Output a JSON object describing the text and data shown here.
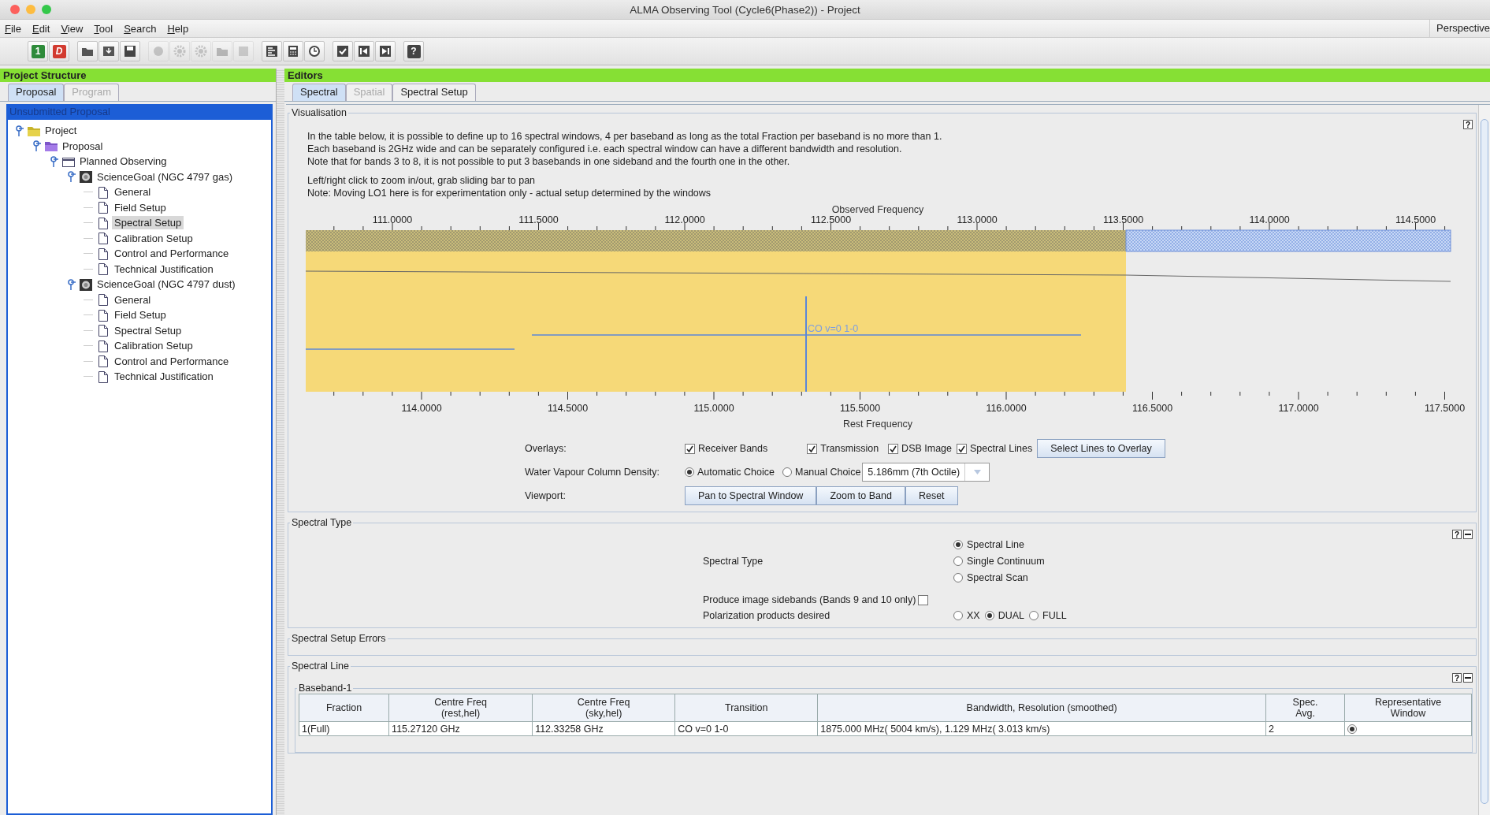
{
  "window": {
    "title": "ALMA Observing Tool (Cycle6(Phase2)) - Project"
  },
  "menu": [
    {
      "label": "File"
    },
    {
      "label": "Edit"
    },
    {
      "label": "View"
    },
    {
      "label": "Tool"
    },
    {
      "label": "Search"
    },
    {
      "label": "Help"
    }
  ],
  "perspective": "Perspective",
  "toolbar": [
    [
      {
        "kind": "green-tile",
        "text": "1",
        "disabled": false
      },
      {
        "kind": "red-tile",
        "text": "D",
        "disabled": false
      }
    ],
    [
      {
        "kind": "folder",
        "disabled": false
      },
      {
        "kind": "import",
        "disabled": false
      },
      {
        "kind": "save",
        "disabled": false
      }
    ],
    [
      {
        "kind": "circle",
        "disabled": true
      },
      {
        "kind": "gear",
        "disabled": true
      },
      {
        "kind": "gear",
        "disabled": true
      },
      {
        "kind": "folder",
        "disabled": true
      },
      {
        "kind": "square",
        "disabled": true
      }
    ],
    [
      {
        "kind": "lines",
        "disabled": false
      },
      {
        "kind": "calculator",
        "disabled": false
      },
      {
        "kind": "clock",
        "disabled": false
      }
    ],
    [
      {
        "kind": "check",
        "disabled": false
      },
      {
        "kind": "first",
        "disabled": false
      },
      {
        "kind": "last",
        "disabled": false
      }
    ],
    [
      {
        "kind": "dark-tile",
        "text": "?",
        "disabled": false
      }
    ]
  ],
  "project_structure": {
    "title": "Project Structure",
    "tabs": [
      {
        "label": "Proposal",
        "selected": true,
        "disabled": false
      },
      {
        "label": "Program",
        "selected": false,
        "disabled": true
      }
    ],
    "tree_header": "Unsubmitted Proposal",
    "tree": [
      {
        "label": "Project",
        "kind": "folder-yellow",
        "expanded": true,
        "selected": false,
        "children": [
          {
            "label": "Proposal",
            "kind": "folder-purple",
            "expanded": true,
            "selected": false,
            "children": [
              {
                "label": "Planned Observing",
                "kind": "window",
                "expanded": true,
                "selected": false,
                "children": [
                  {
                    "label": "ScienceGoal (NGC 4797 gas)",
                    "kind": "goal",
                    "expanded": true,
                    "selected": false,
                    "children": [
                      {
                        "label": "General",
                        "kind": "page",
                        "selected": false
                      },
                      {
                        "label": "Field Setup",
                        "kind": "page",
                        "selected": false
                      },
                      {
                        "label": "Spectral Setup",
                        "kind": "page",
                        "selected": true
                      },
                      {
                        "label": "Calibration Setup",
                        "kind": "page",
                        "selected": false
                      },
                      {
                        "label": "Control and Performance",
                        "kind": "page",
                        "selected": false
                      },
                      {
                        "label": "Technical Justification",
                        "kind": "page",
                        "selected": false
                      }
                    ]
                  },
                  {
                    "label": "ScienceGoal (NGC 4797 dust)",
                    "kind": "goal",
                    "expanded": true,
                    "selected": false,
                    "children": [
                      {
                        "label": "General",
                        "kind": "page",
                        "selected": false
                      },
                      {
                        "label": "Field Setup",
                        "kind": "page",
                        "selected": false
                      },
                      {
                        "label": "Spectral Setup",
                        "kind": "page",
                        "selected": false
                      },
                      {
                        "label": "Calibration Setup",
                        "kind": "page",
                        "selected": false
                      },
                      {
                        "label": "Control and Performance",
                        "kind": "page",
                        "selected": false
                      },
                      {
                        "label": "Technical Justification",
                        "kind": "page",
                        "selected": false
                      }
                    ]
                  }
                ]
              }
            ]
          }
        ]
      }
    ]
  },
  "editors": {
    "title": "Editors",
    "tabs": [
      {
        "label": "Spectral",
        "selected": true,
        "disabled": false
      },
      {
        "label": "Spatial",
        "selected": false,
        "disabled": true
      },
      {
        "label": "Spectral Setup",
        "selected": false,
        "disabled": false
      }
    ],
    "visualisation": {
      "title": "Visualisation",
      "help": "?",
      "notes": [
        [
          "In the table below, it is possible to define up to 16 spectral windows, 4 per baseband as long as the total Fraction per baseband is no more than 1.",
          "Each baseband is 2GHz wide and can be separately configured i.e. each spectral window can have a different bandwidth and resolution.",
          "Note that for bands 3 to 8, it is not possible to put 3 basebands in one sideband and the fourth one in the other."
        ],
        [
          "Left/right click to zoom in/out, grab sliding bar to pan",
          "Note: Moving LO1 here is for experimentation only - actual setup determined by the windows"
        ]
      ],
      "spectrum": {
        "top_axis": {
          "label": "Observed Frequency",
          "ticks": [
            "111.0000",
            "111.5000",
            "112.0000",
            "112.5000",
            "113.0000",
            "113.5000",
            "114.0000",
            "114.5000"
          ]
        },
        "bottom_axis": {
          "label": "Rest Frequency",
          "ticks": [
            "114.0000",
            "114.5000",
            "115.0000",
            "115.5000",
            "116.0000",
            "116.5000",
            "117.0000",
            "117.5000"
          ]
        },
        "line_label": "CO v=0 1-0"
      },
      "overlays": {
        "label": "Overlays:",
        "options": [
          {
            "label": "Receiver Bands",
            "checked": true
          },
          {
            "label": "Transmission",
            "checked": true
          },
          {
            "label": "DSB Image",
            "checked": true
          },
          {
            "label": "Spectral Lines",
            "checked": true
          }
        ],
        "button": "Select Lines to Overlay"
      },
      "water_vapour": {
        "label": "Water Vapour Column Density:",
        "options": [
          {
            "label": "Automatic Choice",
            "selected": true
          },
          {
            "label": "Manual Choice",
            "selected": false
          }
        ],
        "value": "5.186mm (7th Octile)",
        "disabled": true
      },
      "viewport": {
        "label": "Viewport:",
        "buttons": [
          "Pan to Spectral Window",
          "Zoom to Band",
          "Reset"
        ]
      }
    },
    "spectral_type": {
      "title": "Spectral Type",
      "help": "?",
      "label": "Spectral Type",
      "options": [
        {
          "label": "Spectral Line",
          "selected": true
        },
        {
          "label": "Single Continuum",
          "selected": false
        },
        {
          "label": "Spectral Scan",
          "selected": false
        }
      ],
      "sidebands": {
        "label": "Produce image sidebands (Bands 9 and 10 only)",
        "checked": false
      },
      "polarization": {
        "label": "Polarization products desired",
        "options": [
          {
            "label": "XX",
            "selected": false
          },
          {
            "label": "DUAL",
            "selected": true
          },
          {
            "label": "FULL",
            "selected": false
          }
        ]
      }
    },
    "errors": {
      "title": "Spectral Setup Errors"
    },
    "spectral_line": {
      "title": "Spectral Line",
      "help": "?",
      "baseband": "Baseband-1",
      "columns": [
        "Fraction",
        "Centre Freq\n(rest,hel)",
        "Centre Freq\n(sky,hel)",
        "Transition",
        "Bandwidth, Resolution (smoothed)",
        "Spec.\nAvg.",
        "Representative\nWindow"
      ],
      "rows": [
        {
          "cells": [
            "1(Full)",
            "115.27120 GHz",
            "112.33258 GHz",
            "CO v=0 1-0",
            "1875.000 MHz( 5004 km/s),   1.129 MHz( 3.013 km/s)",
            "2"
          ],
          "representative": true
        }
      ]
    }
  }
}
